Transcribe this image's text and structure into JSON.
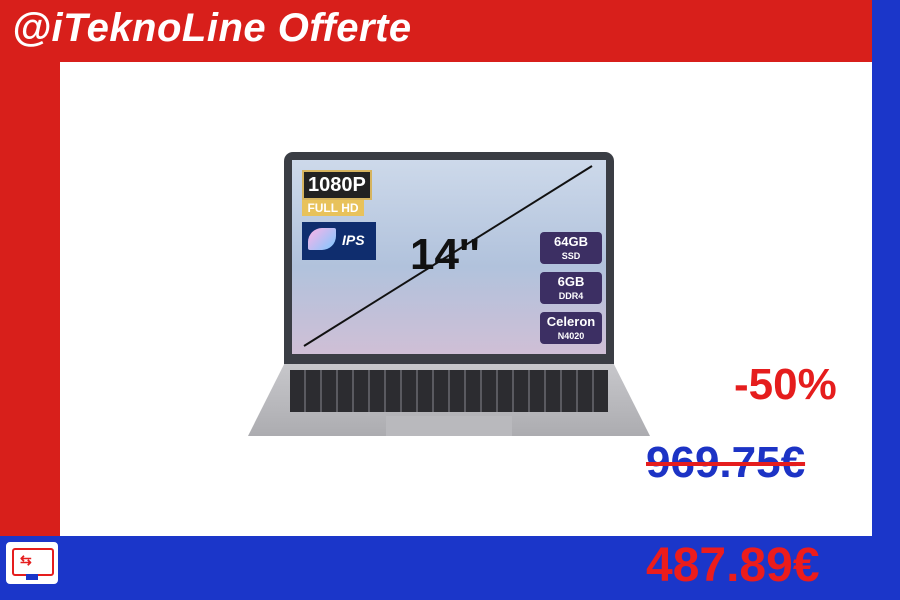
{
  "header": {
    "brand": "@iTeknoLine Offerte"
  },
  "product": {
    "image_alt": "laptop",
    "screen_badges": {
      "resolution": "1080P",
      "resolution_sub": "FULL HD",
      "panel": "IPS",
      "size": "14''"
    },
    "specs": [
      {
        "main": "64GB",
        "sub": "SSD"
      },
      {
        "main": "6GB",
        "sub": "DDR4"
      },
      {
        "main": "Celeron",
        "sub": "N4020"
      }
    ]
  },
  "pricing": {
    "discount": "-50%",
    "original_price": "969.75€",
    "sale_price": "487.89€"
  },
  "colors": {
    "red": "#d81f1b",
    "blue": "#1b36c9",
    "price_red": "#ec1c1c"
  },
  "icons": {
    "logo": "usb-monitor-icon"
  }
}
